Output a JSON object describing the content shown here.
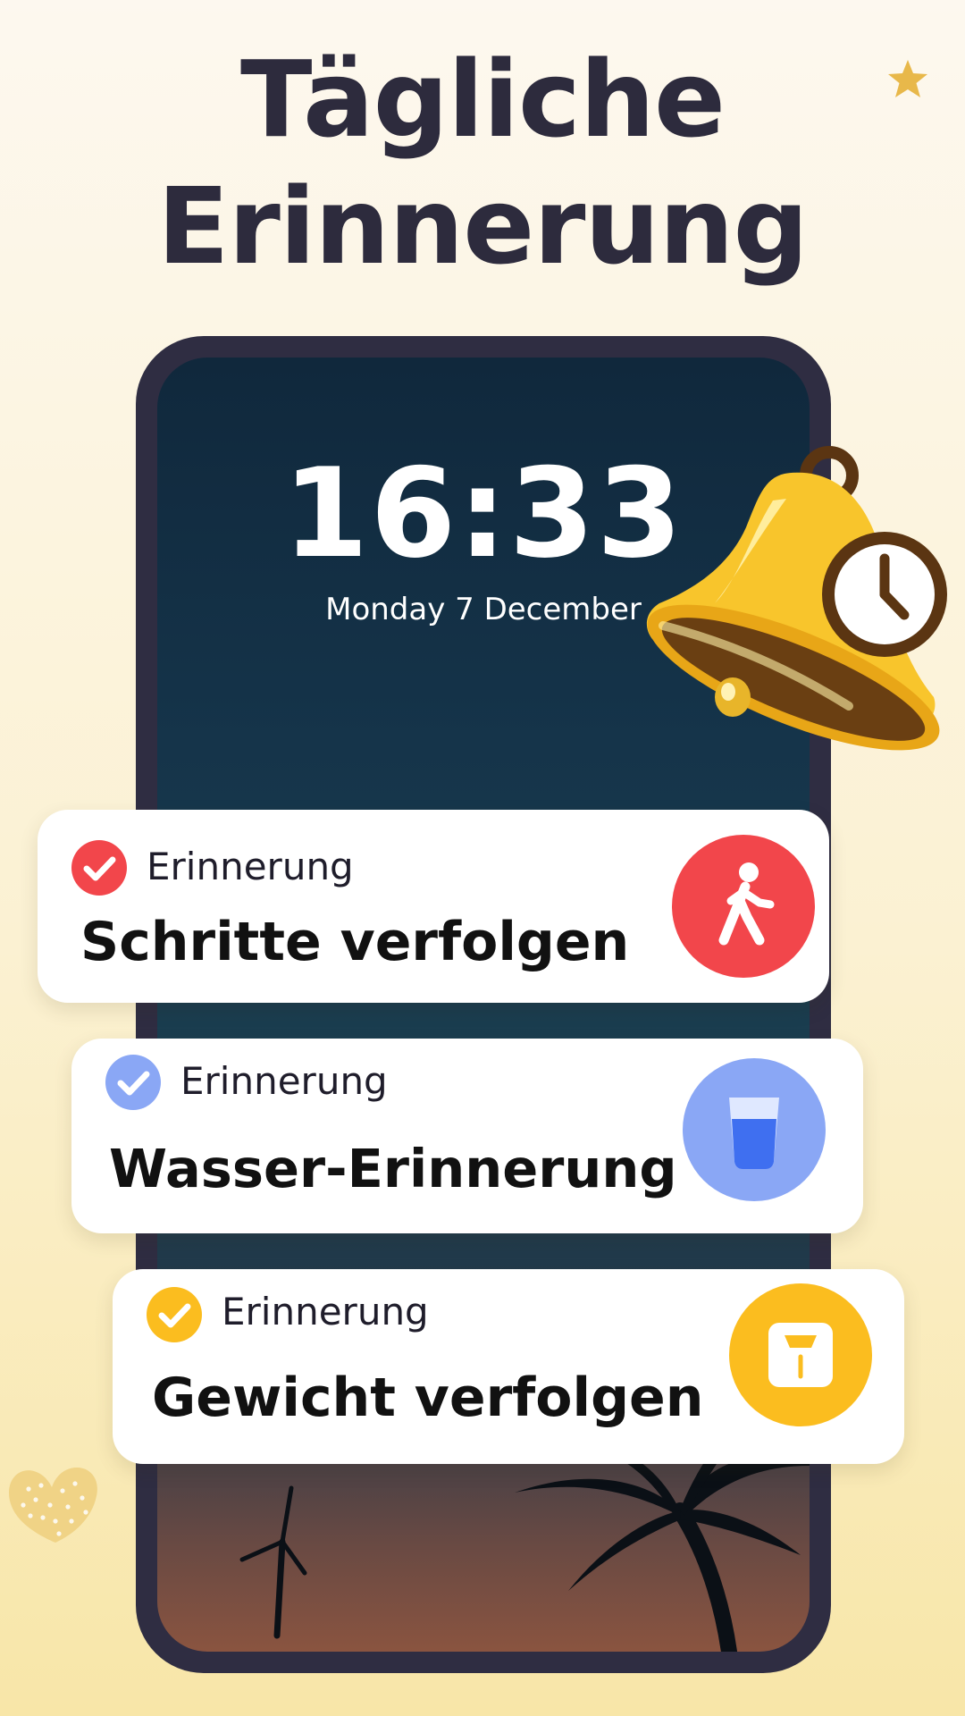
{
  "headline": {
    "line1": "Tägliche",
    "line2": "Erinnerung"
  },
  "lockscreen": {
    "time": "16:33",
    "date": "Monday 7 December"
  },
  "reminders": [
    {
      "label": "Erinnerung",
      "title": "Schritte verfolgen",
      "icon": "walking-person-icon",
      "color": "#f2464b"
    },
    {
      "label": "Erinnerung",
      "title": "Wasser-Erinnerung",
      "icon": "water-glass-icon",
      "color": "#8aa7f5"
    },
    {
      "label": "Erinnerung",
      "title": "Gewicht verfolgen",
      "icon": "weight-scale-icon",
      "color": "#fbbd1f"
    }
  ],
  "colors": {
    "background": "#fbf3dc",
    "text_dark": "#2d2b3d",
    "phone_frame": "#2f2d42",
    "bell_gold": "#f8c52c",
    "clock_brown": "#5b3512"
  }
}
